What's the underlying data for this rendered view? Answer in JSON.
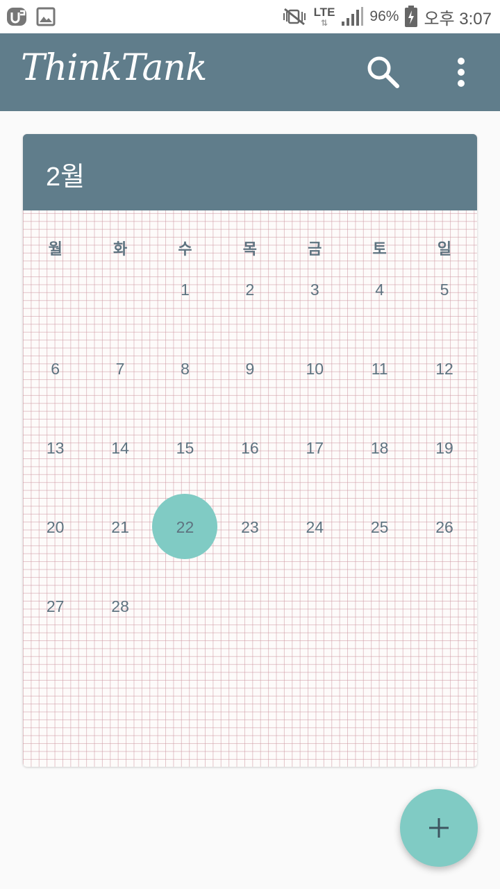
{
  "status_bar": {
    "battery": "96%",
    "network": "LTE",
    "time": "오후 3:07"
  },
  "app_bar": {
    "title": "ThinkTank"
  },
  "calendar": {
    "month_label": "2월",
    "weekdays": [
      "월",
      "화",
      "수",
      "목",
      "금",
      "토",
      "일"
    ],
    "weeks": [
      [
        "",
        "",
        "1",
        "2",
        "3",
        "4",
        "5"
      ],
      [
        "6",
        "7",
        "8",
        "9",
        "10",
        "11",
        "12"
      ],
      [
        "13",
        "14",
        "15",
        "16",
        "17",
        "18",
        "19"
      ],
      [
        "20",
        "21",
        "22",
        "23",
        "24",
        "25",
        "26"
      ],
      [
        "27",
        "28",
        "",
        "",
        "",
        "",
        ""
      ]
    ],
    "selected_day": "22"
  },
  "colors": {
    "primary": "#607d8b",
    "accent": "#80cbc4",
    "day_text": "#5e7380"
  },
  "icons": {
    "search": "search-icon",
    "more": "more-vert-icon",
    "add": "add-icon"
  }
}
